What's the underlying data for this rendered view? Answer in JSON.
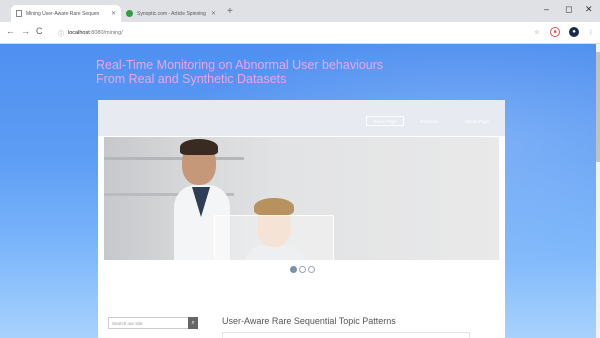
{
  "browser": {
    "tabs": [
      {
        "title": "Mining User-Aware Rare Sequen",
        "active": true
      },
      {
        "title": "Synoptic.com - Article Spinning",
        "active": false
      }
    ],
    "new_tab": "+",
    "window_controls": {
      "minimize": "–",
      "maximize": "◻",
      "close": "✕"
    },
    "nav": {
      "back": "←",
      "forward": "→",
      "reload": "C"
    },
    "address": {
      "host": "localhost",
      "path": ":8080/mining/"
    }
  },
  "page": {
    "title_line1": "Real-Time Monitoring on Abnormal User behaviours",
    "title_line2": "From Real and Synthetic Datasets",
    "nav_links": [
      "Home Page",
      "Services",
      "Media Page"
    ],
    "search_placeholder": "Search our site",
    "section_title": "User-Aware Rare Sequential Topic Patterns"
  },
  "colors": {
    "title": "#e9a6ea",
    "page_bg": "#5e9ef5"
  },
  "icons": {
    "search": "search-icon",
    "star": "star-icon",
    "shield": "shield-icon",
    "menu": "kebab-menu-icon"
  }
}
